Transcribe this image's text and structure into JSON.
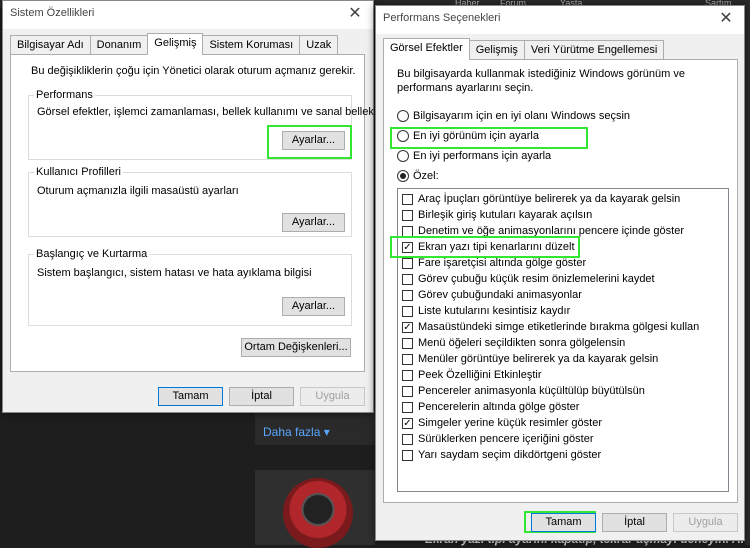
{
  "background": {
    "tabs": [
      "Haber",
      "Forum",
      "Yasta",
      "Sartım"
    ],
    "more_link": "Daha fazla ▾",
    "caption": "Ekran yazı tipi ayarını kapatıp, tekrar açmayı deneyin. Ardında"
  },
  "sysprops": {
    "title": "Sistem Özellikleri",
    "tabs": [
      "Bilgisayar Adı",
      "Donanım",
      "Gelişmiş",
      "Sistem Koruması",
      "Uzak"
    ],
    "active_tab": "Gelişmiş",
    "intro": "Bu değişikliklerin çoğu için Yönetici olarak oturum açmanız gerekir.",
    "performance": {
      "title": "Performans",
      "desc": "Görsel efektler, işlemci zamanlaması, bellek kullanımı ve sanal bellek",
      "button": "Ayarlar..."
    },
    "profiles": {
      "title": "Kullanıcı Profilleri",
      "desc": "Oturum açmanızla ilgili masaüstü ayarları",
      "button": "Ayarlar..."
    },
    "startup": {
      "title": "Başlangıç ve Kurtarma",
      "desc": "Sistem başlangıcı, sistem hatası ve hata ayıklama bilgisi",
      "button": "Ayarlar..."
    },
    "env_button": "Ortam Değişkenleri...",
    "ok": "Tamam",
    "cancel": "İptal",
    "apply": "Uygula"
  },
  "perfopts": {
    "title": "Performans Seçenekleri",
    "tabs": [
      "Görsel Efektler",
      "Gelişmiş",
      "Veri Yürütme Engellemesi"
    ],
    "active_tab": "Görsel Efektler",
    "intro_1": "Bu bilgisayarda kullanmak istediğiniz Windows görünüm ve",
    "intro_2": "performans ayarlarını seçin.",
    "radios": [
      {
        "label": "Bilgisayarım için en iyi olanı Windows seçsin",
        "selected": false
      },
      {
        "label": "En iyi görünüm için ayarla",
        "selected": false
      },
      {
        "label": "En iyi performans için ayarla",
        "selected": false
      },
      {
        "label": "Özel:",
        "selected": true
      }
    ],
    "options": [
      {
        "label": "Araç İpuçları görüntüye belirerek ya da kayarak gelsin",
        "checked": false
      },
      {
        "label": "Birleşik giriş kutuları kayarak açılsın",
        "checked": false
      },
      {
        "label": "Denetim ve öğe animasyonlarını pencere içinde göster",
        "checked": false
      },
      {
        "label": "Ekran yazı tipi kenarlarını düzelt",
        "checked": true
      },
      {
        "label": "Fare işaretçisi altında gölge göster",
        "checked": false
      },
      {
        "label": "Görev çubuğu küçük resim önizlemelerini kaydet",
        "checked": false
      },
      {
        "label": "Görev çubuğundaki animasyonlar",
        "checked": false
      },
      {
        "label": "Liste kutularını kesintisiz kaydır",
        "checked": false
      },
      {
        "label": "Masaüstündeki simge etiketlerinde bırakma gölgesi kullan",
        "checked": true
      },
      {
        "label": "Menü öğeleri seçildikten sonra gölgelensin",
        "checked": false
      },
      {
        "label": "Menüler görüntüye belirerek ya da kayarak gelsin",
        "checked": false
      },
      {
        "label": "Peek Özelliğini Etkinleştir",
        "checked": false
      },
      {
        "label": "Pencereler animasyonla küçültülüp büyütülsün",
        "checked": false
      },
      {
        "label": "Pencerelerin altında gölge göster",
        "checked": false
      },
      {
        "label": "Simgeler yerine küçük resimler göster",
        "checked": true
      },
      {
        "label": "Sürüklerken pencere içeriğini göster",
        "checked": false
      },
      {
        "label": "Yarı saydam seçim dikdörtgeni göster",
        "checked": false
      }
    ],
    "ok": "Tamam",
    "cancel": "İptal",
    "apply": "Uygula"
  },
  "colors": {
    "highlight": "#33e633",
    "accent": "#0078d7"
  }
}
